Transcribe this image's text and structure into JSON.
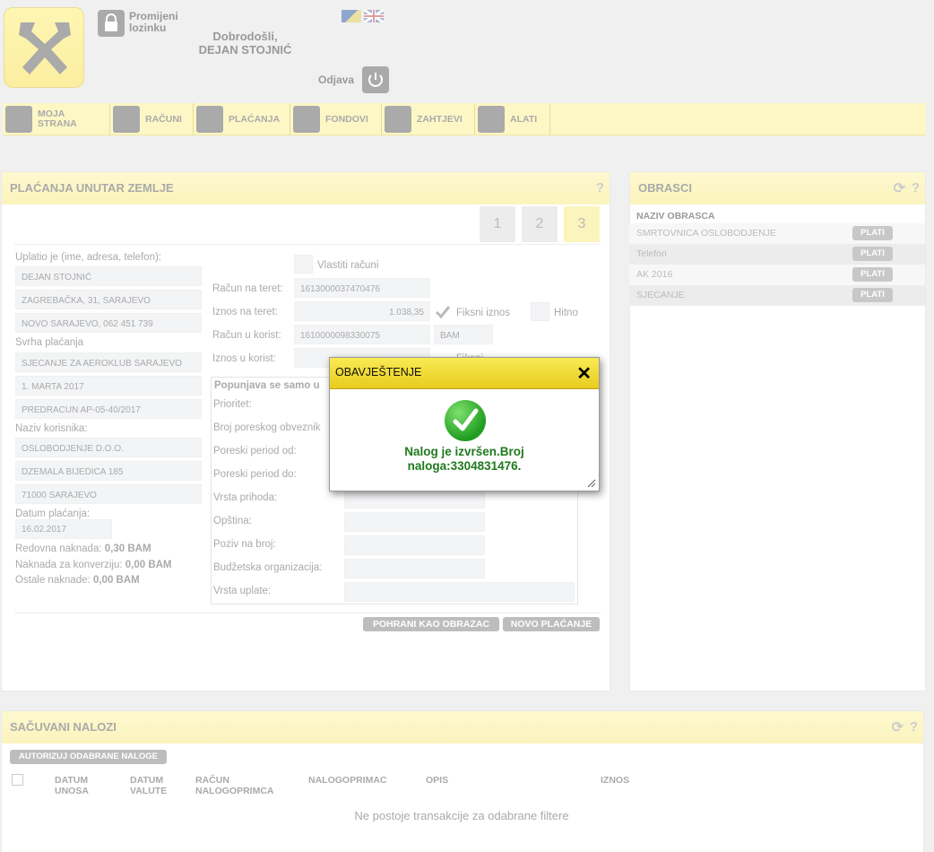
{
  "header": {
    "change_password": "Promijeni lozinku",
    "welcome": "Dobrodošli,",
    "user_name": "DEJAN STOJNIĆ",
    "logout": "Odjava"
  },
  "nav": [
    {
      "label": "MOJA STRANA"
    },
    {
      "label": "RAČUNI"
    },
    {
      "label": "PLAĆANJA"
    },
    {
      "label": "FONDOVI"
    },
    {
      "label": "ZAHTJEVI"
    },
    {
      "label": "ALATI"
    }
  ],
  "payment": {
    "title": "PLAĆANJA UNUTAR ZEMLJE",
    "help": "?",
    "steps": [
      "1",
      "2",
      "3"
    ],
    "payer_label": "Uplatio je (ime, adresa, telefon):",
    "payer_lines": [
      "DEJAN STOJNIĆ",
      "ZAGREBAČKA, 31, SARAJEVO",
      "NOVO SARAJEVO, 062 451 739"
    ],
    "purpose_label": "Svrha plaćanja",
    "purpose_lines": [
      "SJECANJE ZA AEROKLUB SARAJEVO",
      "1. MARTA 2017",
      "PREDRACUN AP-05-40/2017"
    ],
    "recipient_label": "Naziv korisnika:",
    "recipient_lines": [
      "OSLOBODJENJE D.O.O.",
      "DZEMALA BIJEDICA 185",
      "71000 SARAJEVO"
    ],
    "date_label": "Datum plaćanja:",
    "date_value": "16.02.2017",
    "fee_regular_label": "Redovna naknada:",
    "fee_regular_value": "0,30 BAM",
    "fee_conversion_label": "Naknada za konverziju:",
    "fee_conversion_value": "0,00 BAM",
    "fee_other_label": "Ostale naknade:",
    "fee_other_value": "0,00 BAM",
    "own_accounts_label": "Vlastiti računi",
    "debit_account_label": "Račun na teret:",
    "debit_account_value": "1613000037470476",
    "debit_amount_label": "Iznos na teret:",
    "debit_amount_value": "1.038,35",
    "fixed_amount_label": "Fiksni iznos",
    "urgent_label": "Hitno",
    "credit_account_label": "Račun u korist:",
    "credit_account_value": "1610000098330075",
    "currency_value": "BAM",
    "credit_amount_label": "Iznos u korist:",
    "credit_fixed_label": "Fiksni",
    "tax_section_title": "Popunjava se samo u",
    "tax_fields": [
      "Prioritet:",
      "Broj poreskog obveznik",
      "Poreski period od:",
      "Poreski period do:",
      "Vrsta prihoda:",
      "Opština:",
      "Poziv na broj:",
      "Budžetska organizacija:",
      "Vrsta uplate:"
    ],
    "save_template_button": "POHRANI KAO OBRAZAC",
    "new_payment_button": "NOVO PLAĆANJE"
  },
  "templates": {
    "title": "OBRASCI",
    "refresh": "⟳",
    "help": "?",
    "column": "NAZIV OBRASCA",
    "pay_label": "PLATI",
    "rows": [
      "SMRTOVNICA OSLOBODJENJE",
      "Telefon",
      "AK 2016",
      "SJECANJE"
    ]
  },
  "saved_orders": {
    "title": "SAČUVANI NALOZI",
    "refresh": "⟳",
    "help": "?",
    "authorize_button": "AUTORIZUJ ODABRANE NALOGE",
    "columns": [
      "DATUM UNOSA",
      "DATUM VALUTE",
      "RAČUN NALOGOPRIMCA",
      "NALOGOPRIMAC",
      "OPIS",
      "IZNOS"
    ],
    "empty_message": "Ne postoje transakcije za odabrane filtere"
  },
  "modal": {
    "title": "OBAVJEŠTENJE",
    "close": "✕",
    "message_line1": "Nalog je izvršen.Broj",
    "message_line2": "naloga:3304831476."
  }
}
